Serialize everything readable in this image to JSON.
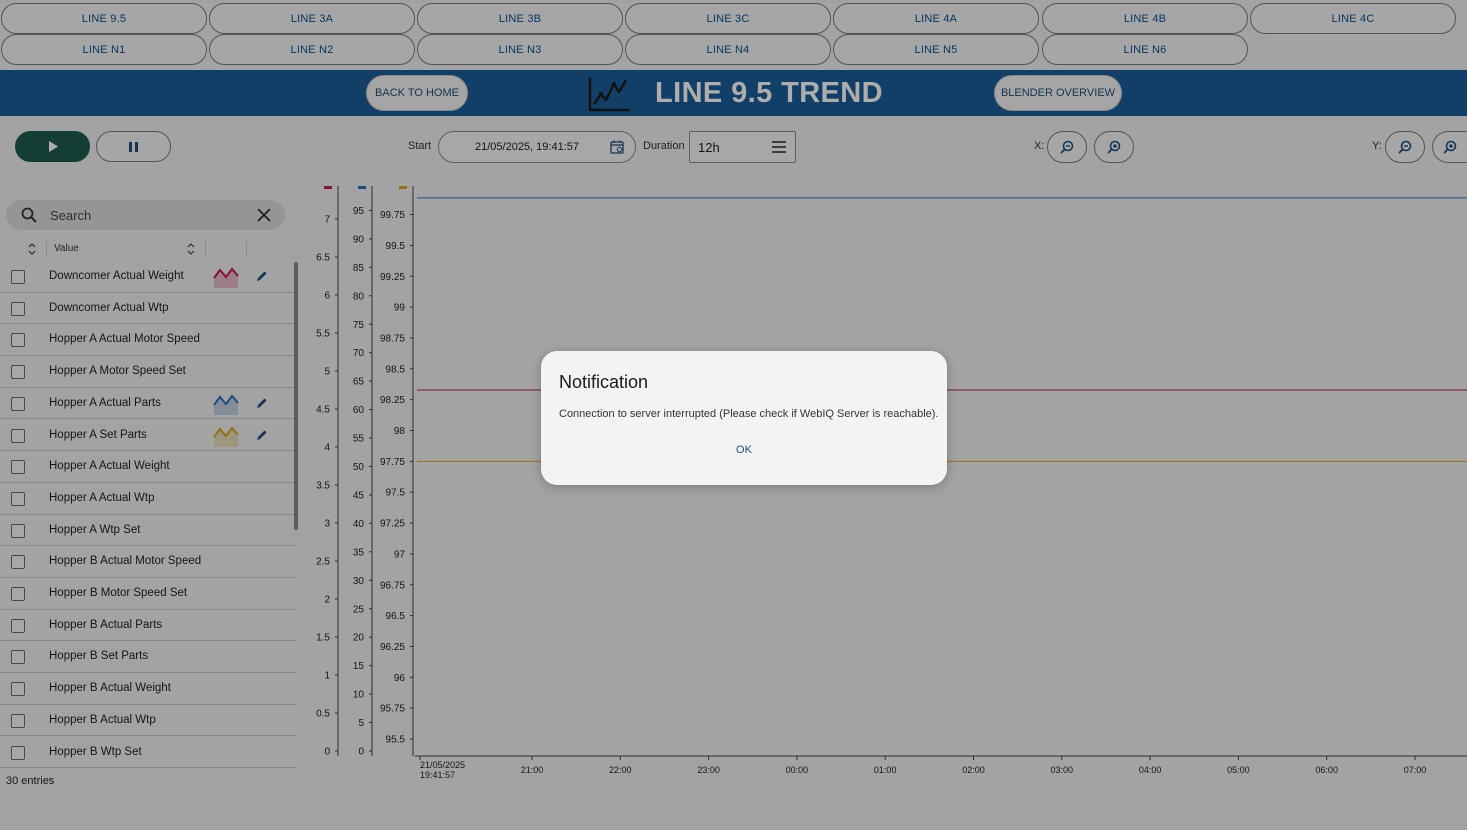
{
  "line_tabs": [
    [
      "LINE 9.5",
      "LINE 3A",
      "LINE 3B",
      "LINE 3C",
      "LINE 4A",
      "LINE 4B",
      "LINE 4C"
    ],
    [
      "LINE N1",
      "LINE N2",
      "LINE N3",
      "LINE N4",
      "LINE N5",
      "LINE N6"
    ]
  ],
  "header": {
    "back_label": "BACK TO HOME",
    "title": "LINE 9.5 TREND",
    "blender_label": "BLENDER OVERVIEW",
    "title_icon": "line-chart-icon",
    "bar_color": "#1b5e9a"
  },
  "controls": {
    "play_icon": "play-icon",
    "pause_icon": "pause-icon",
    "start_label": "Start",
    "start_value": "21/05/2025, 19:41:57",
    "duration_label": "Duration",
    "duration_value": "12h",
    "x_label": "X:",
    "y_label": "Y:"
  },
  "search": {
    "placeholder": "Search"
  },
  "table": {
    "value_header": "Value",
    "rows": [
      {
        "label": "Downcomer Actual Weight",
        "color": "#c2185b",
        "trend": true
      },
      {
        "label": "Downcomer Actual Wtp",
        "trend": false
      },
      {
        "label": "Hopper A Actual Motor Speed",
        "trend": false
      },
      {
        "label": "Hopper A Motor Speed Set",
        "trend": false
      },
      {
        "label": "Hopper A Actual Parts",
        "color": "#2f6fc0",
        "trend": true
      },
      {
        "label": "Hopper A Set Parts",
        "color": "#d9a81e",
        "trend": true
      },
      {
        "label": "Hopper A Actual Weight",
        "trend": false
      },
      {
        "label": "Hopper A Actual Wtp",
        "trend": false
      },
      {
        "label": "Hopper A Wtp Set",
        "trend": false
      },
      {
        "label": "Hopper B Actual Motor Speed",
        "trend": false
      },
      {
        "label": "Hopper B Motor Speed Set",
        "trend": false
      },
      {
        "label": "Hopper B Actual Parts",
        "trend": false
      },
      {
        "label": "Hopper B Set Parts",
        "trend": false
      },
      {
        "label": "Hopper B Actual Weight",
        "trend": false
      },
      {
        "label": "Hopper B Actual Wtp",
        "trend": false
      },
      {
        "label": "Hopper B Wtp Set",
        "trend": false
      }
    ],
    "entries": "30 entries"
  },
  "chart_data": {
    "type": "line",
    "x_ticks": [
      "21/05/2025\n19:41:57",
      "21:00",
      "22:00",
      "23:00",
      "00:00",
      "01:00",
      "02:00",
      "03:00",
      "04:00",
      "05:00",
      "06:00",
      "07:00"
    ],
    "y_axes": [
      {
        "color": "#c2185b",
        "min": 0,
        "max": 7.5,
        "ticks": [
          "0",
          "0.5",
          "1",
          "1.5",
          "2",
          "2.5",
          "3",
          "3.5",
          "4",
          "4.5",
          "5",
          "5.5",
          "6",
          "6.5",
          "7"
        ]
      },
      {
        "color": "#2f6fc0",
        "min": 0,
        "max": 100,
        "ticks": [
          "0",
          "5",
          "10",
          "15",
          "20",
          "25",
          "30",
          "35",
          "40",
          "45",
          "50",
          "55",
          "60",
          "65",
          "70",
          "75",
          "80",
          "85",
          "90",
          "95"
        ]
      },
      {
        "color": "#d9a81e",
        "min": 95.4,
        "max": 99.9,
        "ticks": [
          "95.5",
          "95.75",
          "96",
          "96.25",
          "96.5",
          "96.75",
          "97",
          "97.25",
          "97.5",
          "97.75",
          "98",
          "98.25",
          "98.5",
          "98.75",
          "99",
          "99.25",
          "99.5",
          "99.75"
        ]
      }
    ],
    "series": [
      {
        "name": "Downcomer Actual Weight",
        "color": "#c2185b",
        "axis": 0,
        "value": 4.75
      },
      {
        "name": "Hopper A Actual Parts",
        "color": "#2f6fc0",
        "axis": 1,
        "value": 97.2
      },
      {
        "name": "Hopper A Set Parts",
        "color": "#d9a81e",
        "axis": 2,
        "value": 97.75
      }
    ]
  },
  "dialog": {
    "title": "Notification",
    "message": "Connection to server interrupted (Please check if WebIQ Server is reachable).",
    "ok_label": "OK"
  }
}
